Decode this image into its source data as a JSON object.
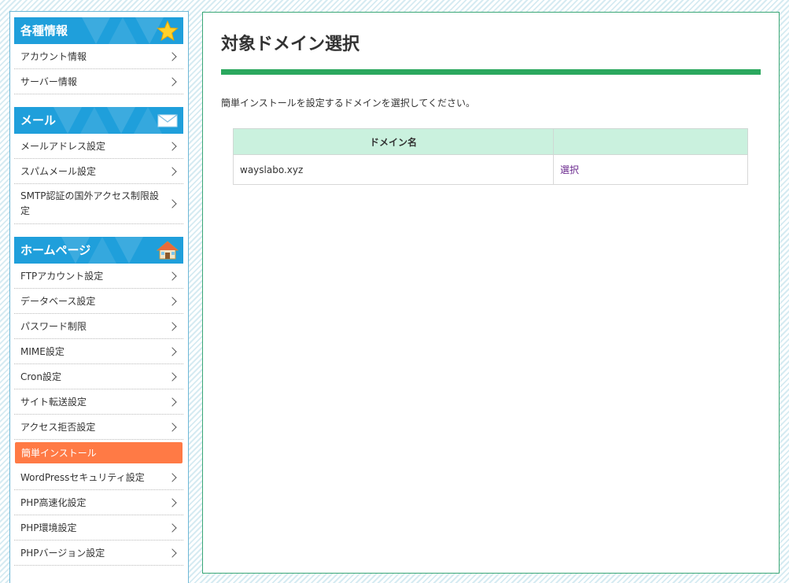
{
  "sidebar": {
    "sections": [
      {
        "title": "各種情報",
        "items": [
          "アカウント情報",
          "サーバー情報"
        ]
      },
      {
        "title": "メール",
        "items": [
          "メールアドレス設定",
          "スパムメール設定",
          "SMTP認証の国外アクセス制限設定"
        ]
      },
      {
        "title": "ホームページ",
        "items": [
          "FTPアカウント設定",
          "データベース設定",
          "パスワード制限",
          "MIME設定",
          "Cron設定",
          "サイト転送設定",
          "アクセス拒否設定",
          "簡単インストール",
          "WordPressセキュリティ設定",
          "PHP高速化設定",
          "PHP環境設定",
          "PHPバージョン設定"
        ],
        "active_item": "簡単インストール"
      }
    ]
  },
  "main": {
    "title": "対象ドメイン選択",
    "description": "簡単インストールを設定するドメインを選択してください。",
    "table": {
      "headers": [
        "ドメイン名",
        ""
      ],
      "rows": [
        {
          "domain": "wayslabo.xyz",
          "action": "選択"
        }
      ]
    }
  },
  "colors": {
    "section_header": "#1f9fdb",
    "active_item": "#ff7a45",
    "title_bar": "#2ba85e",
    "table_header": "#caf1de",
    "link": "#6b2a8f"
  },
  "icons": {
    "info_section": "star-icon",
    "mail_section": "envelope-icon",
    "homepage_section": "house-icon",
    "menu_item": "chevron-right-icon"
  }
}
